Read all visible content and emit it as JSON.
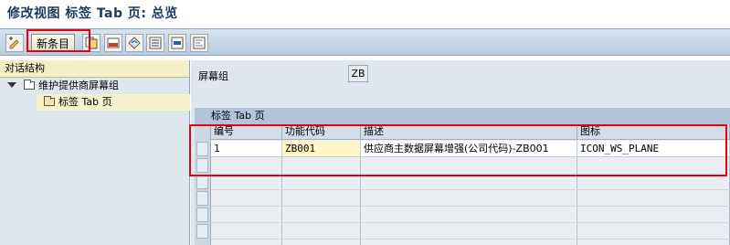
{
  "window": {
    "title": "修改视图 标签 Tab 页: 总览"
  },
  "toolbar": {
    "new_entries_label": "新条目",
    "icons": [
      "display-change-icon",
      "copy-icon",
      "delete-icon",
      "undo-icon",
      "select-all-icon",
      "select-block-icon",
      "deselect-all-icon"
    ]
  },
  "tree": {
    "header": "对话结构",
    "items": [
      {
        "label": "维护提供商屏幕组",
        "expanded": true
      },
      {
        "label": "标签 Tab 页",
        "selected": true
      }
    ]
  },
  "detail": {
    "screen_group_label": "屏幕组",
    "screen_group_value": "ZB"
  },
  "table": {
    "title": "标签 Tab 页",
    "columns": [
      "编号",
      "功能代码",
      "描述",
      "图标"
    ],
    "rows": [
      {
        "number": "1",
        "function_code": "ZB001",
        "description": "供应商主数据屏幕增强(公司代码)-ZB001",
        "icon": "ICON_WS_PLANE"
      }
    ]
  },
  "colors": {
    "highlight": "#e60012",
    "title": "#1f3a5f",
    "header_bg": "#f4eec6"
  }
}
